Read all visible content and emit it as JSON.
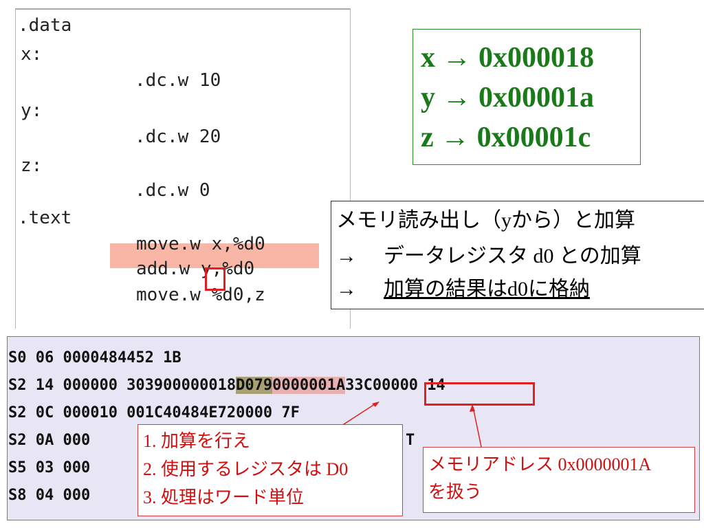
{
  "code_panel": {
    "lines": [
      ".data",
      "x:",
      ".dc.w 10",
      "y:",
      ".dc.w 20",
      "z:",
      ".dc.w 0",
      ".text",
      "move.w x,%d0",
      "add.w y,%d0",
      "move.w %d0,z"
    ]
  },
  "address_box": {
    "lines": [
      "x → 0x000018",
      "y → 0x00001a",
      "z → 0x00001c"
    ],
    "color": "#1a7a1a"
  },
  "explanation": {
    "line1": "メモリ読み出し（yから）と加算",
    "line2_arrow": "→",
    "line2_text": "データレジスタ d0 との加算",
    "line3_arrow": "→",
    "line3_text": "加算の結果はd0に格納"
  },
  "srec": {
    "lines": [
      "S0 06 0000484452 1B",
      "S2 14 000000 303900000018",
      "S2 0C 000010 001C40484E720000 7F",
      "S2 0A 000",
      "S5 03 000",
      "S8 04 000"
    ],
    "line2_seg_d079": "D079",
    "line2_seg_addr": "0000001A",
    "line2_tail": "33C00000 14",
    "line4_tail": "T"
  },
  "callout_instructions": {
    "items": [
      "1. 加算を行え",
      "2. 使用するレジスタは D0",
      "3. 処理はワード単位"
    ]
  },
  "callout_memory": {
    "line1": "メモリアドレス 0x0000001A",
    "line2": "を扱う"
  },
  "colors": {
    "highlight_row": "#f8b7a6",
    "red_box": "#e02020",
    "srec_bg": "#e8e6f4"
  }
}
